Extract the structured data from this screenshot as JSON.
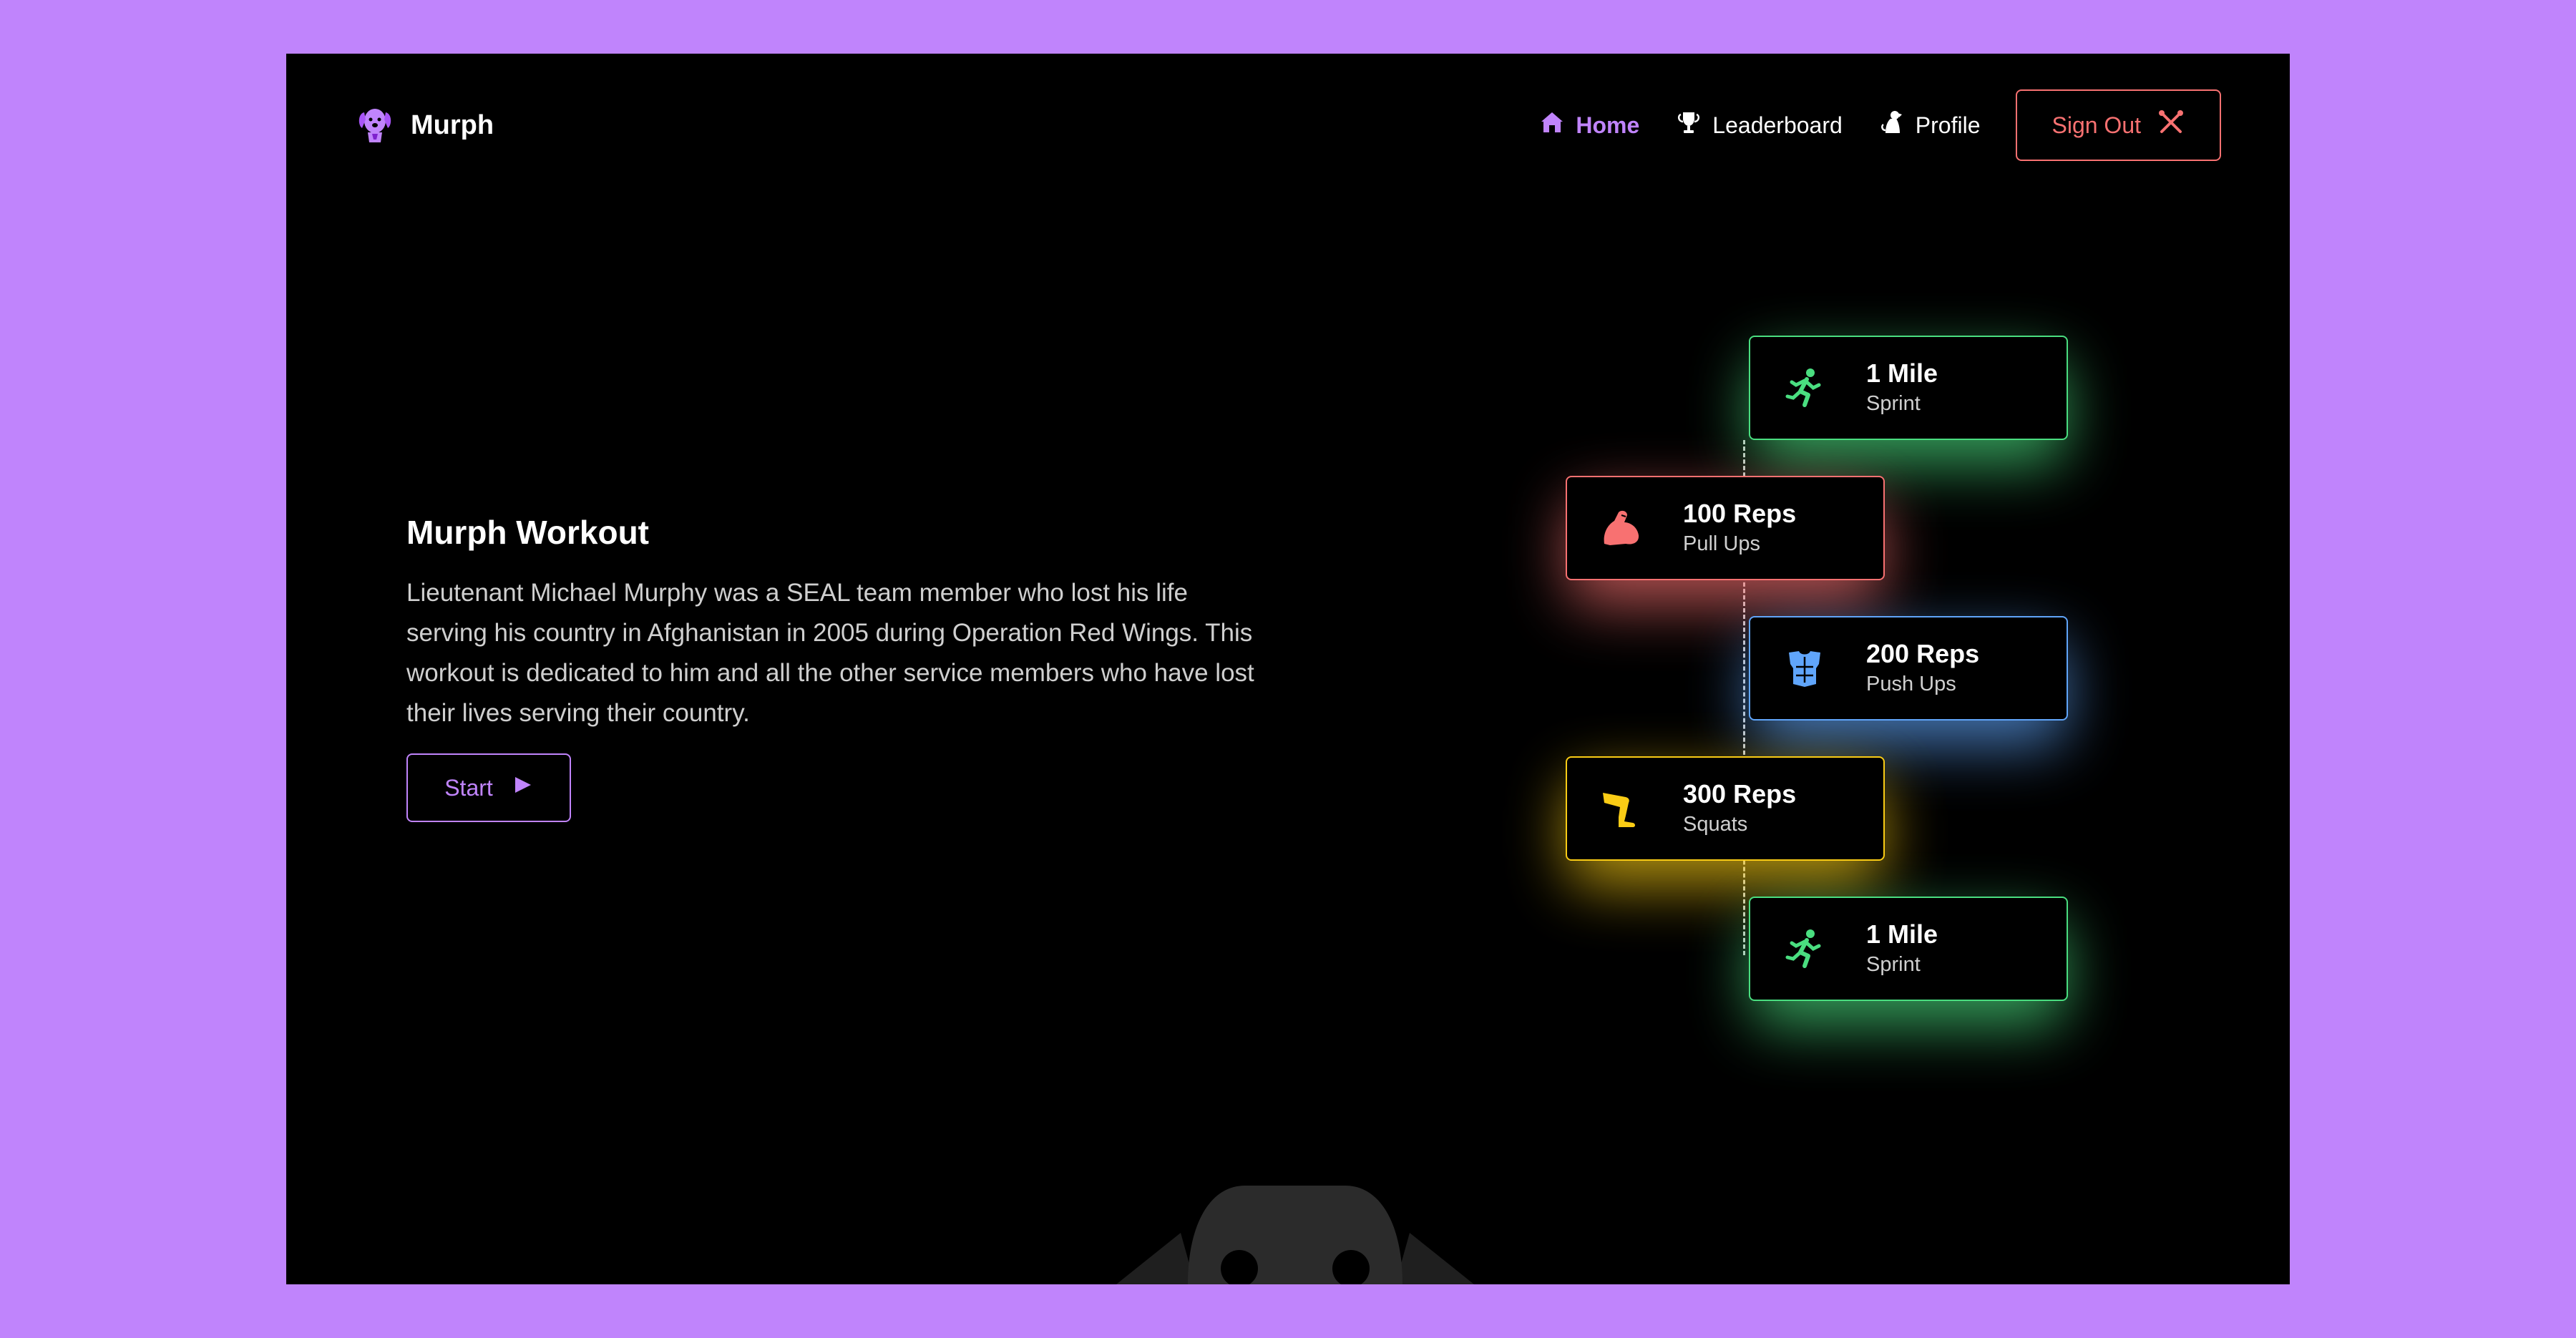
{
  "app": {
    "name": "Murph",
    "accent": "#c084fc"
  },
  "nav": {
    "items": [
      {
        "label": "Home",
        "icon": "house-icon",
        "active": true
      },
      {
        "label": "Leaderboard",
        "icon": "trophy-icon",
        "active": false
      },
      {
        "label": "Profile",
        "icon": "dog-icon",
        "active": false
      }
    ],
    "sign_out": {
      "label": "Sign Out",
      "icon": "crossed-tools-icon",
      "color": "#f87171"
    }
  },
  "hero": {
    "title": "Murph Workout",
    "description": "Lieutenant Michael Murphy was a SEAL team member who lost his life serving his country in Afghanistan in 2005 during Operation Red Wings. This workout is dedicated to him and all the other service members who have lost their lives serving their country.",
    "start_label": "Start"
  },
  "steps": [
    {
      "title": "1 Mile",
      "subtitle": "Sprint",
      "icon": "runner-icon",
      "color": "#4ade80"
    },
    {
      "title": "100 Reps",
      "subtitle": "Pull Ups",
      "icon": "flexed-bicep-icon",
      "color": "#f87171"
    },
    {
      "title": "200 Reps",
      "subtitle": "Push Ups",
      "icon": "chest-armor-icon",
      "color": "#60a5fa"
    },
    {
      "title": "300 Reps",
      "subtitle": "Squats",
      "icon": "leg-icon",
      "color": "#facc15"
    },
    {
      "title": "1 Mile",
      "subtitle": "Sprint",
      "icon": "runner-icon",
      "color": "#4ade80"
    }
  ]
}
